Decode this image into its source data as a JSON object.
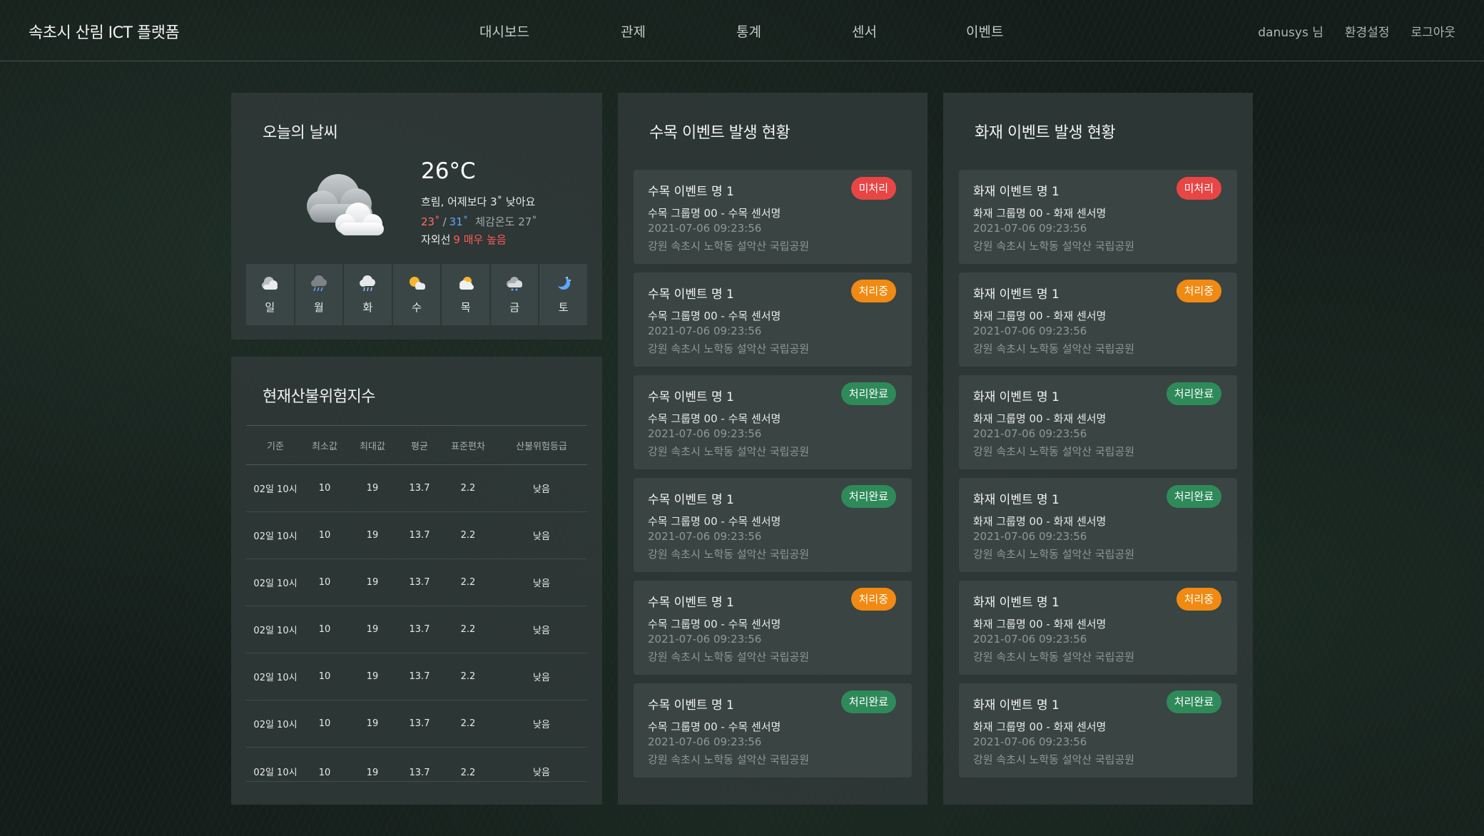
{
  "brand": "속초시 산림 ICT 플랫폼",
  "nav": [
    "대시보드",
    "관제",
    "통계",
    "센서",
    "이벤트"
  ],
  "user": {
    "name": "danusys 님",
    "settings": "환경설정",
    "logout": "로그아웃"
  },
  "weather": {
    "title": "오늘의 날씨",
    "temp": "26°C",
    "desc": "흐림, 어제보다 3˚ 낮아요",
    "low": "23˚",
    "sep": "/",
    "high": "31˚",
    "feel": "체감온도 27˚",
    "uv_label": "자외선",
    "uv_level": "9 매우 높음",
    "days": [
      {
        "label": "일",
        "icon": "cloud-icon"
      },
      {
        "label": "월",
        "icon": "storm-icon"
      },
      {
        "label": "화",
        "icon": "rain-icon"
      },
      {
        "label": "수",
        "icon": "sun-cloud-icon"
      },
      {
        "label": "목",
        "icon": "sun-cloud-icon"
      },
      {
        "label": "금",
        "icon": "rain-cloud-icon"
      },
      {
        "label": "토",
        "icon": "moon-icon"
      }
    ]
  },
  "risk": {
    "title": "현재산불위험지수",
    "columns": [
      "기준",
      "최소값",
      "최대값",
      "평균",
      "표준편차",
      "산불위험등급"
    ],
    "rows": [
      [
        "02일 10시",
        "10",
        "19",
        "13.7",
        "2.2",
        "낮음"
      ],
      [
        "02일 10시",
        "10",
        "19",
        "13.7",
        "2.2",
        "낮음"
      ],
      [
        "02일 10시",
        "10",
        "19",
        "13.7",
        "2.2",
        "낮음"
      ],
      [
        "02일 10시",
        "10",
        "19",
        "13.7",
        "2.2",
        "낮음"
      ],
      [
        "02일 10시",
        "10",
        "19",
        "13.7",
        "2.2",
        "낮음"
      ],
      [
        "02일 10시",
        "10",
        "19",
        "13.7",
        "2.2",
        "낮음"
      ],
      [
        "02일 10시",
        "10",
        "19",
        "13.7",
        "2.2",
        "낮음"
      ]
    ]
  },
  "tree_events": {
    "title": "수목 이벤트 발생 현황",
    "items": [
      {
        "name": "수목 이벤트 명 1",
        "status": "미처리",
        "sub": "수목 그룹명 00 - 수목 센서명",
        "time": "2021-07-06 09:23:56",
        "loc": "강원 속초시 노학동 설악산 국립공원"
      },
      {
        "name": "수목 이벤트 명 1",
        "status": "처리중",
        "sub": "수목 그룹명 00 - 수목 센서명",
        "time": "2021-07-06 09:23:56",
        "loc": "강원 속초시 노학동 설악산 국립공원"
      },
      {
        "name": "수목 이벤트 명 1",
        "status": "처리완료",
        "sub": "수목 그룹명 00 - 수목 센서명",
        "time": "2021-07-06 09:23:56",
        "loc": "강원 속초시 노학동 설악산 국립공원"
      },
      {
        "name": "수목 이벤트 명 1",
        "status": "처리완료",
        "sub": "수목 그룹명 00 - 수목 센서명",
        "time": "2021-07-06 09:23:56",
        "loc": "강원 속초시 노학동 설악산 국립공원"
      },
      {
        "name": "수목 이벤트 명 1",
        "status": "처리중",
        "sub": "수목 그룹명 00 - 수목 센서명",
        "time": "2021-07-06 09:23:56",
        "loc": "강원 속초시 노학동 설악산 국립공원"
      },
      {
        "name": "수목 이벤트 명 1",
        "status": "처리완료",
        "sub": "수목 그룹명 00 - 수목 센서명",
        "time": "2021-07-06 09:23:56",
        "loc": "강원 속초시 노학동 설악산 국립공원"
      }
    ]
  },
  "fire_events": {
    "title": "화재 이벤트 발생 현황",
    "items": [
      {
        "name": "화재 이벤트 명 1",
        "status": "미처리",
        "sub": "화재 그룹명 00 - 화재 센서명",
        "time": "2021-07-06 09:23:56",
        "loc": "강원 속초시 노학동 설악산 국립공원"
      },
      {
        "name": "화재 이벤트 명 1",
        "status": "처리중",
        "sub": "화재 그룹명 00 - 화재 센서명",
        "time": "2021-07-06 09:23:56",
        "loc": "강원 속초시 노학동 설악산 국립공원"
      },
      {
        "name": "화재 이벤트 명 1",
        "status": "처리완료",
        "sub": "화재 그룹명 00 - 화재 센서명",
        "time": "2021-07-06 09:23:56",
        "loc": "강원 속초시 노학동 설악산 국립공원"
      },
      {
        "name": "화재 이벤트 명 1",
        "status": "처리완료",
        "sub": "화재 그룹명 00 - 화재 센서명",
        "time": "2021-07-06 09:23:56",
        "loc": "강원 속초시 노학동 설악산 국립공원"
      },
      {
        "name": "화재 이벤트 명 1",
        "status": "처리중",
        "sub": "화재 그룹명 00 - 화재 센서명",
        "time": "2021-07-06 09:23:56",
        "loc": "강원 속초시 노학동 설악산 국립공원"
      },
      {
        "name": "화재 이벤트 명 1",
        "status": "처리완료",
        "sub": "화재 그룹명 00 - 화재 센서명",
        "time": "2021-07-06 09:23:56",
        "loc": "강원 속초시 노학동 설악산 국립공원"
      }
    ]
  },
  "status_colors": {
    "미처리": "#e84545",
    "처리중": "#f08a12",
    "처리완료": "#2f8a5a"
  }
}
